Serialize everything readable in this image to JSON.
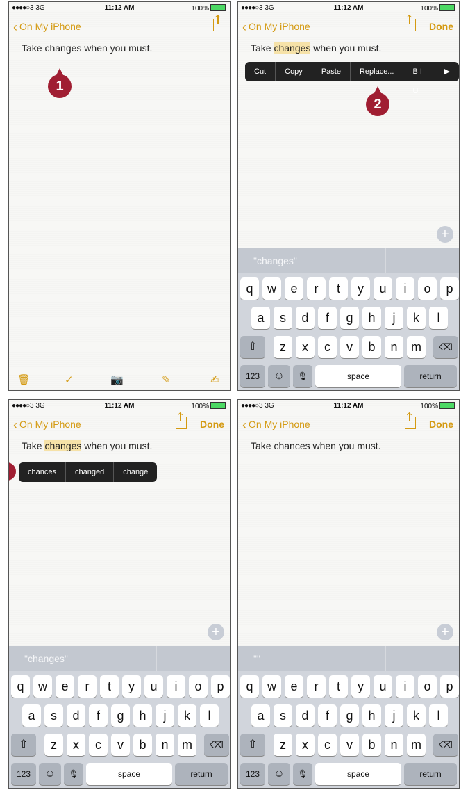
{
  "status": {
    "signal": "●●●●○",
    "network": "3  3G",
    "time": "11:12 AM",
    "battery": "100%"
  },
  "nav": {
    "back_label": "On My iPhone",
    "done_label": "Done"
  },
  "note": {
    "text_pre": "Take ",
    "word": "changes",
    "text_post": " when you must.",
    "final_text": "Take chances when you must."
  },
  "edit_menu": [
    "Cut",
    "Copy",
    "Paste",
    "Replace...",
    "B I U",
    "▶"
  ],
  "replace_menu": [
    "chances",
    "changed",
    "change"
  ],
  "steps": [
    "1",
    "2"
  ],
  "predictions": {
    "panel2": "\"changes\"",
    "panel3": "\"changes\"",
    "panel4": "\"\""
  },
  "keyboard": {
    "row1": [
      "q",
      "w",
      "e",
      "r",
      "t",
      "y",
      "u",
      "i",
      "o",
      "p"
    ],
    "row2": [
      "a",
      "s",
      "d",
      "f",
      "g",
      "h",
      "j",
      "k",
      "l"
    ],
    "row3": [
      "z",
      "x",
      "c",
      "v",
      "b",
      "n",
      "m"
    ],
    "num_key": "123",
    "space_key": "space",
    "return_key": "return"
  },
  "icons": {
    "shift": "⇧",
    "delete": "⌫",
    "emoji": "☺",
    "mic": "🎙",
    "plus": "+",
    "trash": "🗑",
    "check": "✓",
    "camera": "📷",
    "sketch": "✎",
    "compose": "✍"
  },
  "colors": {
    "accent": "#d49a12",
    "step_badge": "#a01e32",
    "highlight": "#f6e2a8"
  }
}
